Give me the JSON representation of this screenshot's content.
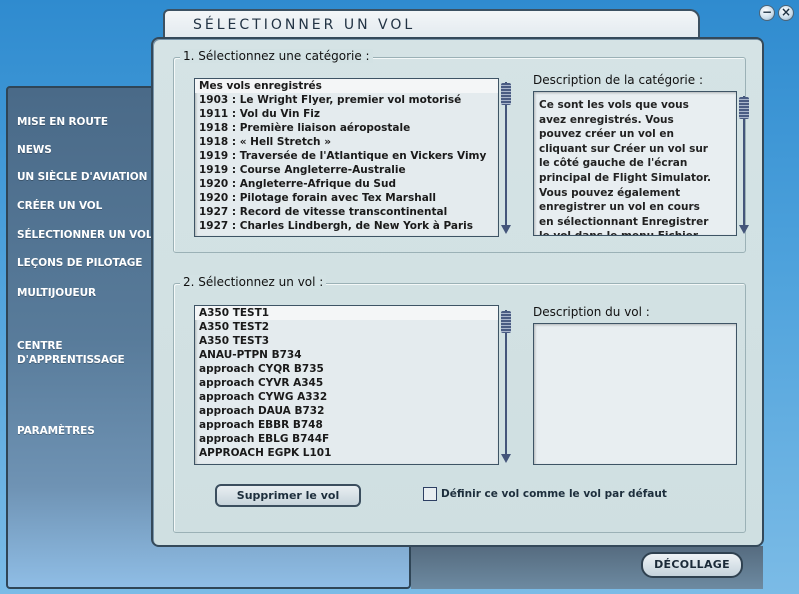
{
  "window": {
    "minimize_label": "−",
    "close_label": "×"
  },
  "title": "SÉLECTIONNER UN VOL",
  "nav": {
    "items": [
      {
        "label": "MISE EN ROUTE"
      },
      {
        "label": "NEWS"
      },
      {
        "label": "UN SIÈCLE D'AVIATION"
      },
      {
        "label": "CRÉER UN VOL"
      },
      {
        "label": "SÉLECTIONNER UN VOL"
      },
      {
        "label": "LEÇONS DE PILOTAGE"
      },
      {
        "label": "MULTIJOUEUR"
      },
      {
        "label": "CENTRE"
      },
      {
        "label": "D'APPRENTISSAGE"
      },
      {
        "label": "PARAMÈTRES"
      }
    ]
  },
  "section1": {
    "label": "1. Sélectionnez une catégorie :",
    "desc_label": "Description de la catégorie :",
    "categories": [
      "Mes vols enregistrés",
      "1903 : Le Wright Flyer, premier vol motorisé",
      "1911 : Vol du Vin Fiz",
      "1918 : Première liaison aéropostale",
      "1918 : « Hell Stretch »",
      "1919 : Traversée de l'Atlantique en Vickers Vimy",
      "1919 : Course Angleterre-Australie",
      "1920 : Angleterre-Afrique du Sud",
      "1920 : Pilotage forain avec Tex Marshall",
      "1927 : Record de vitesse transcontinental",
      "1927 : Charles Lindbergh, de New York à Paris"
    ],
    "description": "Ce sont les vols que vous avez enregistrés. Vous pouvez créer un vol en cliquant sur Créer un vol sur le côté gauche de l'écran principal de Flight Simulator. Vous pouvez également enregistrer un vol en cours en sélectionnant Enregistrer le vol dans le menu Fichier. Pour savoir comment"
  },
  "section2": {
    "label": "2. Sélectionnez un vol :",
    "desc_label": "Description du vol :",
    "flights": [
      "A350 TEST1",
      "A350 TEST2",
      "A350 TEST3",
      "ANAU-PTPN B734",
      "approach CYQR B735",
      "approach CYVR A345",
      "approach CYWG A332",
      "approach DAUA B732",
      "approach EBBR B748",
      "approach EBLG B744F",
      "APPROACH EGPK L101"
    ],
    "description": "",
    "delete_label": "Supprimer le vol",
    "default_label": "Définir ce vol comme le vol par défaut",
    "default_checked": false
  },
  "takeoff_label": "DÉCOLLAGE"
}
